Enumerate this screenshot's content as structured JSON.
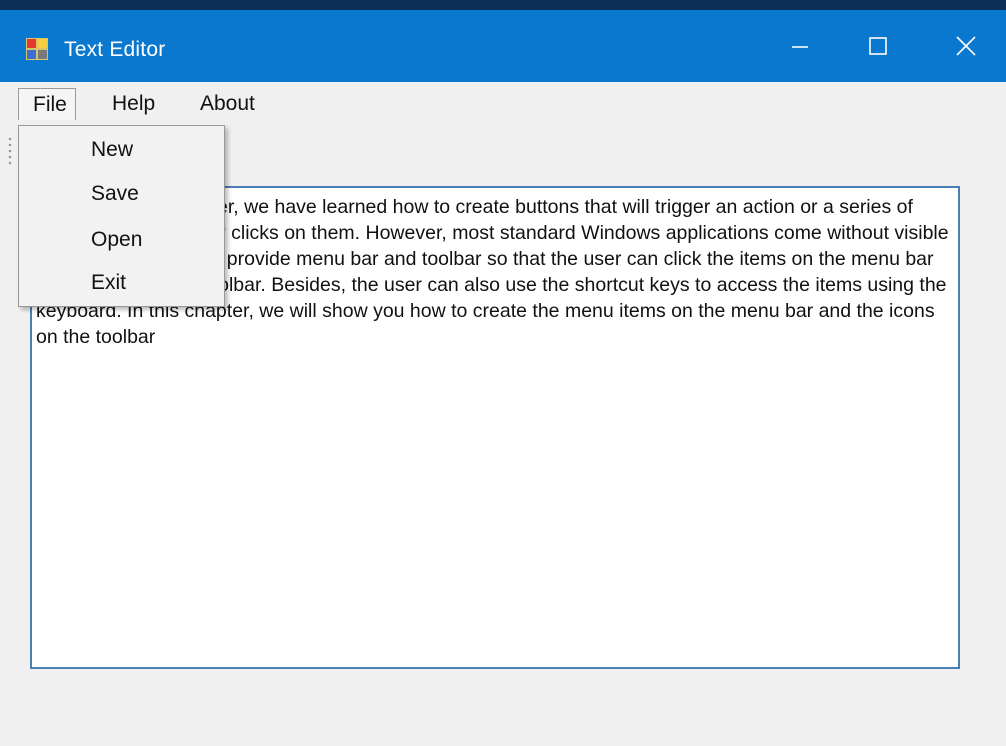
{
  "window": {
    "title": "Text Editor",
    "titlebar_color": "#0a78cf",
    "app_icon": "app-window-icon",
    "controls": [
      "minimize-icon",
      "maximize-icon",
      "close-icon"
    ]
  },
  "menubar": {
    "items": [
      {
        "label": "File",
        "state": "open"
      },
      {
        "label": "Help"
      },
      {
        "label": "About"
      }
    ]
  },
  "file_menu": {
    "items": [
      {
        "label": "New"
      },
      {
        "label": "Save"
      },
      {
        "label": "Open"
      },
      {
        "label": "Exit"
      }
    ]
  },
  "editor": {
    "text": "In the previous chapter, we have learned how to create buttons that will trigger an action or a series of actions when the user clicks on them. However, most standard Windows applications come without visible buttons, instead, they provide menu bar and toolbar so that the user can click the items on the menu bar or the icons on the toolbar. Besides, the user can also use the shortcut keys to access the items using the keyboard. In this chapter, we will show you how to create the menu items on the menu bar and the icons on the toolbar",
    "border_color": "#4a7fb5"
  }
}
